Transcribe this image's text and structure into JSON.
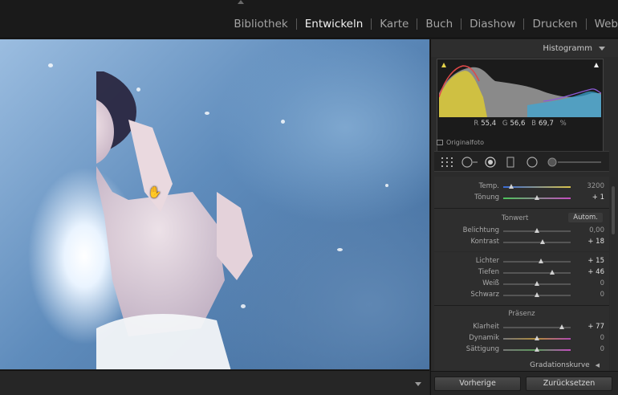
{
  "modules": [
    "Bibliothek",
    "Entwickeln",
    "Karte",
    "Buch",
    "Diashow",
    "Drucken",
    "Web"
  ],
  "active_module": "Entwickeln",
  "panel": {
    "histogram_title": "Histogramm",
    "rgb": {
      "r_label": "R",
      "r": "55,4",
      "g_label": "G",
      "g": "56,6",
      "b_label": "B",
      "b": "69,7",
      "unit": "%"
    },
    "original_label": "Originalfoto"
  },
  "sliders": {
    "temp": {
      "label": "Temp.",
      "value": "3200",
      "pos": 0.12
    },
    "tint": {
      "label": "Tönung",
      "value": "+ 1",
      "pos": 0.5
    },
    "tone_title": "Tonwert",
    "auto": "Autom.",
    "exposure": {
      "label": "Belichtung",
      "value": "0,00",
      "pos": 0.5
    },
    "contrast": {
      "label": "Kontrast",
      "value": "+ 18",
      "pos": 0.59
    },
    "highlights": {
      "label": "Lichter",
      "value": "+ 15",
      "pos": 0.57
    },
    "shadows": {
      "label": "Tiefen",
      "value": "+ 46",
      "pos": 0.73
    },
    "whites": {
      "label": "Weiß",
      "value": "0",
      "pos": 0.5
    },
    "blacks": {
      "label": "Schwarz",
      "value": "0",
      "pos": 0.5
    },
    "presence_title": "Präsenz",
    "clarity": {
      "label": "Klarheit",
      "value": "+ 77",
      "pos": 0.88
    },
    "vibrance": {
      "label": "Dynamik",
      "value": "0",
      "pos": 0.5
    },
    "saturation": {
      "label": "Sättigung",
      "value": "0",
      "pos": 0.5
    }
  },
  "curve_section": "Gradationskurve",
  "buttons": {
    "previous": "Vorherige",
    "reset": "Zurücksetzen"
  }
}
